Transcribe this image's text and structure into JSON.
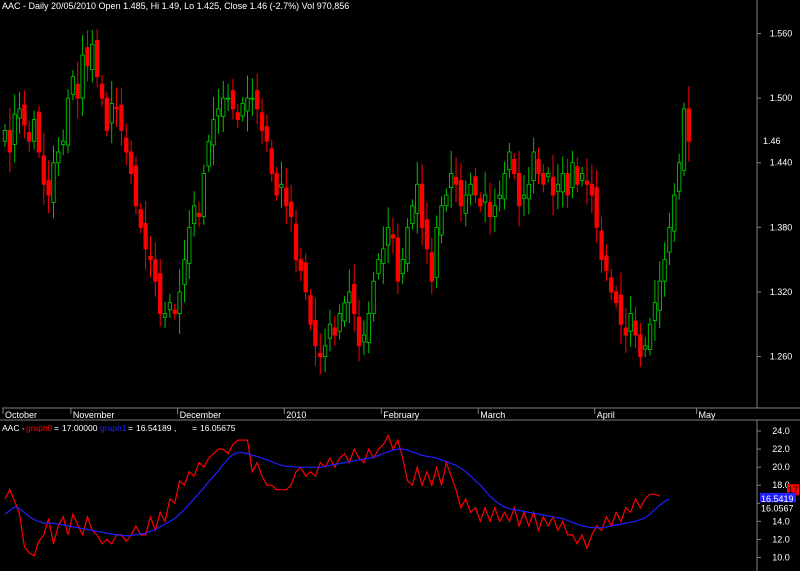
{
  "header": {
    "symbol": "AAC",
    "info": "AAC - Daily 20/05/2010 Open 1.485, Hi 1.49, Lo 1.425, Close 1.46 (-2.7%) Vol 970,856"
  },
  "colors": {
    "background": "#000000",
    "up": "#00c000",
    "down": "#ff0000",
    "graph0": "#ff0000",
    "graph1": "#2020ff",
    "text": "#ffffff",
    "axis": "#808080"
  },
  "chart_data": [
    {
      "type": "candlestick",
      "title": "AAC - Daily 20/05/2010 Open 1.485, Hi 1.49, Lo 1.425, Close 1.46 (-2.7%) Vol 970,856",
      "ylim": [
        1.215,
        1.58
      ],
      "y_ticks": [
        "1.560",
        "1.500",
        "1.440",
        "1.380",
        "1.320",
        "1.260"
      ],
      "last_price_label": "1.46",
      "x_labels": [
        "October",
        "November",
        "December",
        "2010",
        "February",
        "March",
        "April",
        "May"
      ],
      "x_label_index": [
        0,
        14,
        36,
        58,
        78,
        98,
        122,
        143
      ],
      "closes": [
        1.47,
        1.45,
        1.485,
        1.49,
        1.475,
        1.46,
        1.48,
        1.45,
        1.42,
        1.41,
        1.44,
        1.45,
        1.46,
        1.5,
        1.52,
        1.5,
        1.54,
        1.53,
        1.55,
        1.52,
        1.5,
        1.47,
        1.495,
        1.49,
        1.47,
        1.45,
        1.43,
        1.4,
        1.38,
        1.36,
        1.35,
        1.33,
        1.3,
        1.3,
        1.31,
        1.3,
        1.32,
        1.35,
        1.38,
        1.4,
        1.39,
        1.43,
        1.46,
        1.48,
        1.49,
        1.5,
        1.5,
        1.49,
        1.48,
        1.495,
        1.5,
        1.5,
        1.49,
        1.47,
        1.46,
        1.43,
        1.41,
        1.42,
        1.4,
        1.39,
        1.35,
        1.34,
        1.32,
        1.29,
        1.27,
        1.26,
        1.27,
        1.29,
        1.28,
        1.3,
        1.31,
        1.32,
        1.3,
        1.27,
        1.28,
        1.3,
        1.33,
        1.35,
        1.36,
        1.38,
        1.37,
        1.33,
        1.35,
        1.38,
        1.4,
        1.42,
        1.38,
        1.36,
        1.33,
        1.38,
        1.4,
        1.41,
        1.43,
        1.42,
        1.4,
        1.41,
        1.42,
        1.41,
        1.4,
        1.41,
        1.39,
        1.4,
        1.41,
        1.43,
        1.45,
        1.43,
        1.4,
        1.41,
        1.42,
        1.45,
        1.43,
        1.42,
        1.43,
        1.41,
        1.42,
        1.43,
        1.41,
        1.44,
        1.42,
        1.43,
        1.42,
        1.41,
        1.38,
        1.35,
        1.34,
        1.32,
        1.31,
        1.29,
        1.28,
        1.3,
        1.28,
        1.26,
        1.27,
        1.29,
        1.31,
        1.33,
        1.35,
        1.38,
        1.41,
        1.44,
        1.49,
        1.46
      ]
    },
    {
      "type": "line",
      "legend_prefix": "AAC -",
      "series": [
        {
          "name": "graph0",
          "value_label": "17.00000",
          "color": "#ff0000",
          "values": [
            16.5,
            17.5,
            16.2,
            14.8,
            11.2,
            10.5,
            10.2,
            11.8,
            12.5,
            14.3,
            11.5,
            13.5,
            14.5,
            12.5,
            14.8,
            13.6,
            12.5,
            14.5,
            13.0,
            12.5,
            11.5,
            12.0,
            11.5,
            12.5,
            12.5,
            11.8,
            12.5,
            13.5,
            12.5,
            12.5,
            14.5,
            13.0,
            15.0,
            14.0,
            16.5,
            16.0,
            18.5,
            18.0,
            19.5,
            19.0,
            20.5,
            20.0,
            21.0,
            21.5,
            22.0,
            22.0,
            21.5,
            22.5,
            23.0,
            23.0,
            23.0,
            19.5,
            20.5,
            19.0,
            18.0,
            18.0,
            17.5,
            17.5,
            17.5,
            18.0,
            19.5,
            20.0,
            19.0,
            19.5,
            19.0,
            20.5,
            20.0,
            21.0,
            20.0,
            21.0,
            21.5,
            20.5,
            22.0,
            21.0,
            20.5,
            22.0,
            21.0,
            22.0,
            22.5,
            23.5,
            22.0,
            23.0,
            21.0,
            18.5,
            18.0,
            20.0,
            18.0,
            19.5,
            18.0,
            20.0,
            18.0,
            20.5,
            19.0,
            17.5,
            15.5,
            16.5,
            15.0,
            15.5,
            14.0,
            15.5,
            14.0,
            15.5,
            14.0,
            15.0,
            14.0,
            15.5,
            13.5,
            15.0,
            13.5,
            15.0,
            13.0,
            14.5,
            13.5,
            14.5,
            13.0,
            14.0,
            12.5,
            12.5,
            11.5,
            12.5,
            11.0,
            12.5,
            13.5,
            13.0,
            14.5,
            13.5,
            15.0,
            14.0,
            15.5,
            15.0,
            16.5,
            15.5,
            16.5,
            17.0,
            17.0,
            16.8
          ]
        },
        {
          "name": "graph1",
          "value_label": "16.54189",
          "color": "#2020ff",
          "values": [
            14.8,
            15.2,
            15.6,
            15.4,
            15.0,
            14.5,
            14.2,
            14.0,
            13.8,
            13.8,
            13.8,
            13.7,
            13.6,
            13.5,
            13.4,
            13.3,
            13.2,
            13.1,
            13.0,
            12.9,
            12.8,
            12.7,
            12.6,
            12.5,
            12.45,
            12.4,
            12.45,
            12.5,
            12.6,
            12.7,
            12.9,
            13.1,
            13.4,
            13.7,
            14.0,
            14.3,
            14.8,
            15.3,
            15.9,
            16.5,
            17.1,
            17.7,
            18.4,
            19.0,
            19.6,
            20.3,
            20.9,
            21.4,
            21.6,
            21.6,
            21.5,
            21.3,
            21.2,
            21.0,
            20.8,
            20.6,
            20.4,
            20.2,
            20.1,
            20.1,
            20.0,
            20.0,
            20.0,
            20.0,
            20.0,
            20.0,
            20.1,
            20.2,
            20.3,
            20.4,
            20.5,
            20.6,
            20.7,
            20.8,
            20.9,
            21.0,
            21.1,
            21.3,
            21.5,
            21.7,
            21.9,
            22.0,
            22.0,
            21.9,
            21.7,
            21.5,
            21.3,
            21.2,
            21.1,
            21.0,
            20.8,
            20.6,
            20.4,
            20.2,
            19.9,
            19.5,
            19.0,
            18.5,
            18.0,
            17.4,
            16.8,
            16.3,
            15.9,
            15.6,
            15.4,
            15.3,
            15.2,
            15.1,
            15.0,
            14.9,
            14.8,
            14.7,
            14.6,
            14.5,
            14.4,
            14.3,
            14.1,
            13.9,
            13.7,
            13.5,
            13.4,
            13.3,
            13.3,
            13.3,
            13.4,
            13.5,
            13.6,
            13.7,
            13.8,
            13.9,
            14.0,
            14.2,
            14.4,
            14.8,
            15.3,
            15.8,
            16.2,
            16.5
          ]
        },
        {
          "name": "",
          "value_label": "16.05675",
          "color": "#ffffff",
          "values": []
        }
      ],
      "ylim": [
        9.5,
        25
      ],
      "y_ticks": [
        "24.0",
        "22.0",
        "20.0",
        "18.0",
        "16.0",
        "14.0",
        "12.0",
        "10.0"
      ],
      "badges": [
        {
          "text": "17",
          "bg": "#ff0000",
          "fg": "#000000",
          "value": 17.5
        },
        {
          "text": "16.5419",
          "bg": "#2020ff",
          "fg": "#ffffff",
          "value": 16.54
        },
        {
          "text": "16.0567",
          "bg": "#000000",
          "fg": "#ffffff",
          "value": 15.5
        }
      ]
    }
  ]
}
